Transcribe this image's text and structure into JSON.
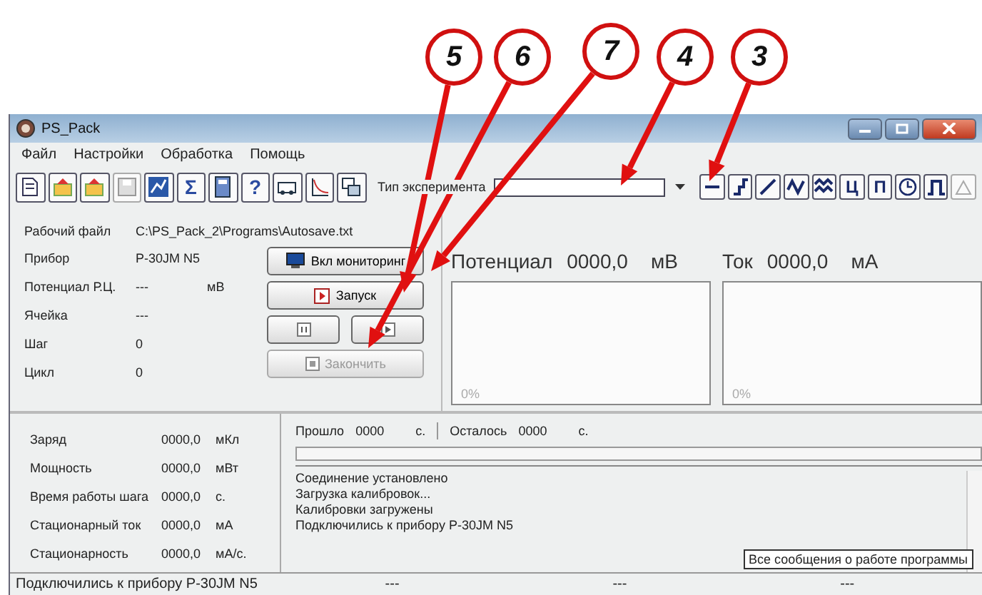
{
  "callouts": [
    {
      "number": "5"
    },
    {
      "number": "6"
    },
    {
      "number": "7"
    },
    {
      "number": "4"
    },
    {
      "number": "3"
    }
  ],
  "window": {
    "title": "PS_Pack"
  },
  "menu": [
    {
      "label": "Файл"
    },
    {
      "label": "Настройки"
    },
    {
      "label": "Обработка"
    },
    {
      "label": "Помощь"
    }
  ],
  "toolbar_left": [
    {
      "kind": "new",
      "disabled": false
    },
    {
      "kind": "open",
      "disabled": false
    },
    {
      "kind": "open",
      "disabled": false
    },
    {
      "kind": "save",
      "disabled": true
    },
    {
      "kind": "chart",
      "disabled": false
    },
    {
      "kind": "char",
      "label": "Σ",
      "disabled": false
    },
    {
      "kind": "calc",
      "disabled": false
    },
    {
      "kind": "char",
      "label": "?",
      "disabled": false
    },
    {
      "kind": "device",
      "disabled": false
    },
    {
      "kind": "curve",
      "disabled": false
    },
    {
      "kind": "windows",
      "disabled": false
    }
  ],
  "experiment_type": {
    "label": "Тип эксперимента"
  },
  "toolbar_right": [
    {
      "kind": "hline",
      "disabled": false
    },
    {
      "kind": "step",
      "disabled": false
    },
    {
      "kind": "ramp",
      "disabled": false
    },
    {
      "kind": "wave",
      "disabled": false
    },
    {
      "kind": "multiwave",
      "disabled": false
    },
    {
      "kind": "char",
      "label": "Ц",
      "disabled": false
    },
    {
      "kind": "char",
      "label": "П",
      "disabled": false
    },
    {
      "kind": "clock",
      "disabled": false
    },
    {
      "kind": "pulse",
      "disabled": false
    },
    {
      "kind": "triangle",
      "disabled": true
    }
  ],
  "work_file": {
    "label": "Рабочий файл",
    "value": "C:\\PS_Pack_2\\Programs\\Autosave.txt"
  },
  "info": [
    {
      "label": "Прибор",
      "value": "P-30JM N5"
    },
    {
      "label": "Потенциал Р.Ц.",
      "value": "---",
      "unit": "мВ"
    },
    {
      "label": "Ячейка",
      "value": "---"
    },
    {
      "label": "Шаг",
      "value": "0"
    },
    {
      "label": "Цикл",
      "value": "0"
    }
  ],
  "controls": {
    "monitor": {
      "label": "Вкл мониторинг"
    },
    "start": {
      "label": "Запуск"
    },
    "stop": {
      "label": "Закончить",
      "disabled": true
    }
  },
  "meters": [
    {
      "label": "Потенциал",
      "value": "0000,0",
      "unit": "мВ",
      "scale": "0%"
    },
    {
      "label": "Ток",
      "value": "0000,0",
      "unit": "мА",
      "scale": "0%"
    }
  ],
  "stats": [
    {
      "label": "Заряд",
      "value": "0000,0",
      "unit": "мКл"
    },
    {
      "label": "Мощность",
      "value": "0000,0",
      "unit": "мВт"
    },
    {
      "label": "Время работы шага",
      "value": "0000,0",
      "unit": "с."
    },
    {
      "label": "Стационарный ток",
      "value": "0000,0",
      "unit": "мА"
    },
    {
      "label": "Стационарность",
      "value": "0000,0",
      "unit": "мА/с."
    }
  ],
  "timer": {
    "elapsed_label": "Прошло",
    "elapsed": "0000",
    "elapsed_unit": "с.",
    "remaining_label": "Осталось",
    "remaining": "0000",
    "remaining_unit": "с."
  },
  "progress": {
    "level": 0
  },
  "log": [
    "Соединение установлено",
    "Загрузка калибровок...",
    "Калибровки загружены",
    "Подключились к прибору P-30JM N5"
  ],
  "tooltip": "Все сообщения о работе программы",
  "status_bar": [
    "Подключились к прибору P-30JM N5",
    "---",
    "---",
    "---"
  ]
}
